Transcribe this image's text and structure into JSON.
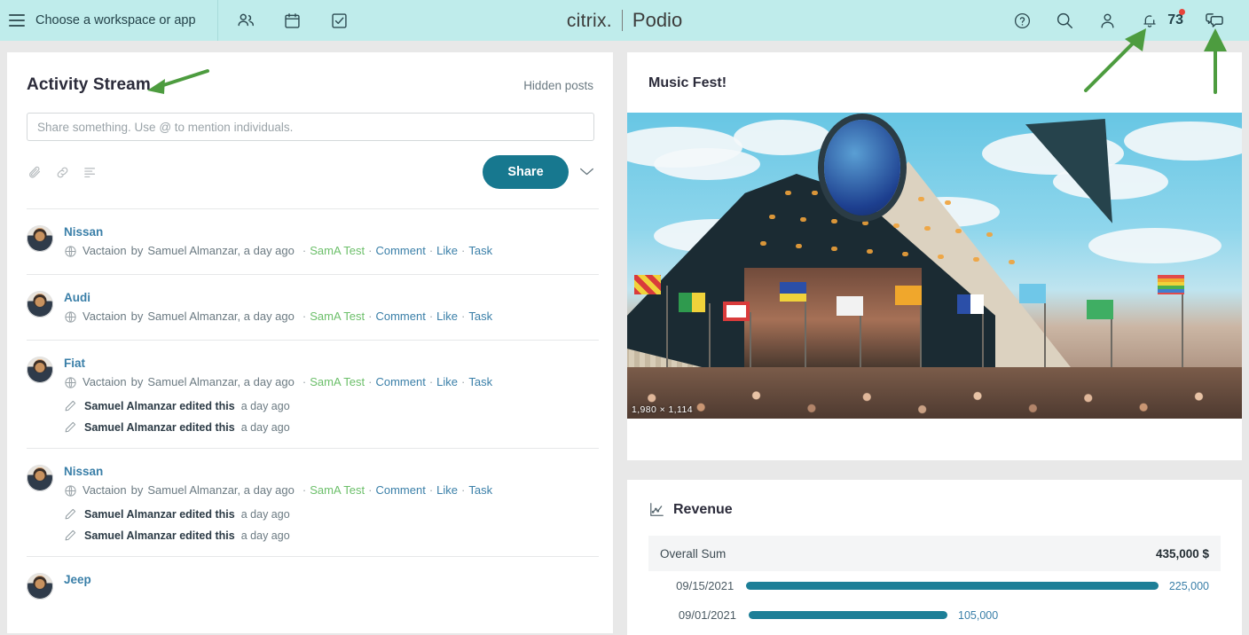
{
  "topbar": {
    "menu_icon": "hamburger-icon",
    "workspace_chooser": "Choose a workspace or app",
    "left_icons": [
      "contacts-icon",
      "calendar-icon",
      "tasks-icon"
    ],
    "brand_left": "citrix.",
    "brand_right": "Podio",
    "right_icons": [
      "help-icon",
      "search-icon",
      "profile-icon",
      "notifications-bell-icon",
      "chat-icon"
    ],
    "notification_count": "73",
    "notification_dot_color": "#e8443a",
    "background_color": "#bfeceb"
  },
  "activity_stream": {
    "title": "Activity Stream",
    "hidden_posts_label": "Hidden posts",
    "composer": {
      "placeholder": "Share something. Use @ to mention individuals.",
      "value": "",
      "icons": [
        "attachment-icon",
        "link-icon",
        "poll-icon"
      ],
      "share_label": "Share",
      "share_color": "#17788f",
      "dropdown_icon": "chevron-down-icon"
    },
    "items": [
      {
        "title": "Nissan",
        "app": "Vactaion",
        "by": "by",
        "author": "Samuel Almanzar, a day ago",
        "workspace": "SamA Test",
        "actions": [
          "Comment",
          "Like",
          "Task"
        ],
        "edits": []
      },
      {
        "title": "Audi",
        "app": "Vactaion",
        "by": "by",
        "author": "Samuel Almanzar, a day ago",
        "workspace": "SamA Test",
        "actions": [
          "Comment",
          "Like",
          "Task"
        ],
        "edits": []
      },
      {
        "title": "Fiat",
        "app": "Vactaion",
        "by": "by",
        "author": "Samuel Almanzar, a day ago",
        "workspace": "SamA Test",
        "actions": [
          "Comment",
          "Like",
          "Task"
        ],
        "edits": [
          {
            "name": "Samuel Almanzar edited this",
            "time": "a day ago"
          },
          {
            "name": "Samuel Almanzar edited this",
            "time": "a day ago"
          }
        ]
      },
      {
        "title": "Nissan",
        "app": "Vactaion",
        "by": "by",
        "author": "Samuel Almanzar, a day ago",
        "workspace": "SamA Test",
        "actions": [
          "Comment",
          "Like",
          "Task"
        ],
        "edits": [
          {
            "name": "Samuel Almanzar edited this",
            "time": "a day ago"
          },
          {
            "name": "Samuel Almanzar edited this",
            "time": "a day ago"
          }
        ]
      },
      {
        "title": "Jeep",
        "app": "",
        "by": "",
        "author": "",
        "workspace": "",
        "actions": [],
        "edits": []
      }
    ]
  },
  "music_widget": {
    "title": "Music Fest!",
    "image_alt": "festival-pyramid-stage-photo",
    "image_dimensions": "1,980 × 1,114"
  },
  "revenue_widget": {
    "icon": "line-chart-icon",
    "title": "Revenue",
    "summary_label": "Overall Sum",
    "summary_value": "435,000 $",
    "bar_color": "#1d7f97",
    "chart_data": {
      "type": "bar",
      "title": "Revenue",
      "orientation": "horizontal",
      "categories": [
        "09/15/2021",
        "09/01/2021"
      ],
      "values": [
        225000,
        105000
      ],
      "value_labels": [
        "225,000",
        "105,000"
      ],
      "xlabel": "",
      "ylabel": "",
      "xlim": [
        0,
        225000
      ],
      "grid": false,
      "legend": "none",
      "total_label": "Overall Sum",
      "total_value": 435000,
      "total_value_label": "435,000 $"
    }
  },
  "annotations": {
    "color": "#4d9c3f",
    "arrows": [
      {
        "name": "arrow-to-activity-stream",
        "direction": "left"
      },
      {
        "name": "arrow-to-notifications",
        "direction": "up-right"
      },
      {
        "name": "arrow-to-chat",
        "direction": "up"
      }
    ]
  }
}
